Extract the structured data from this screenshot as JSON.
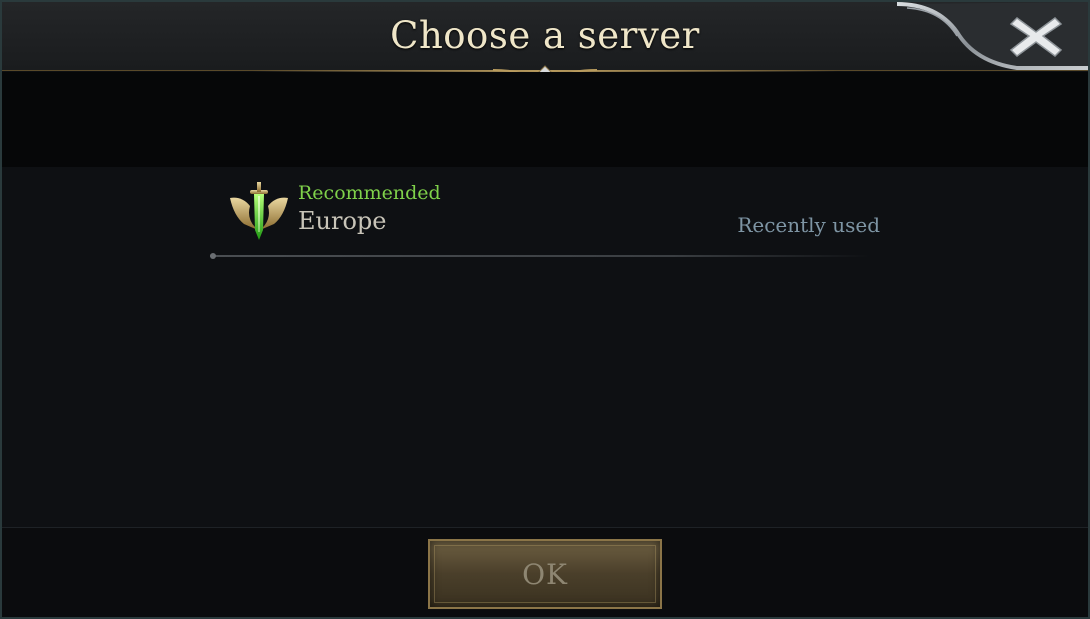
{
  "dialog": {
    "title": "Choose a server",
    "close_icon": "close-icon"
  },
  "server_list": {
    "items": [
      {
        "tag": "Recommended",
        "name": "Europe",
        "status": "Recently used",
        "icon": "sword-emblem-icon"
      }
    ]
  },
  "footer": {
    "ok_label": "OK"
  },
  "colors": {
    "title": "#efe6c8",
    "recommended": "#7fd14a",
    "server_name": "#c8c4b8",
    "recently_used": "#7e95a4",
    "gold_accent": "#b89b5e",
    "ok_text": "#8e8672"
  }
}
